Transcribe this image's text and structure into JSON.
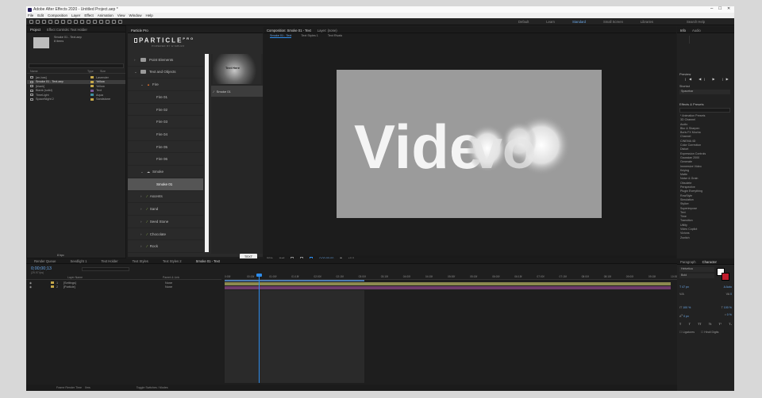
{
  "app": {
    "title": "Adobe After Effects 2020 - Untitled Project.aep *"
  },
  "menu": [
    "File",
    "Edit",
    "Composition",
    "Layer",
    "Effect",
    "Animation",
    "View",
    "Window",
    "Help"
  ],
  "workspaces": [
    "Default",
    "Learn",
    "Standard",
    "Small Screen",
    "Libraries"
  ],
  "search_label": "Search Help",
  "project": {
    "tabs": [
      "Project",
      "Effect Controls: Text Holder"
    ],
    "selected_name": "Smoke 01 - Text.aep",
    "items_label": "8 items",
    "columns": [
      "Name",
      "Type",
      "Size"
    ],
    "items": [
      {
        "name": "[an-bas]",
        "color": "#c6a84a",
        "type": "Lavender"
      },
      {
        "name": "Smoke 01 - Text.aep",
        "color": "#c6a84a",
        "type": "Yellow"
      },
      {
        "name": "[blank]",
        "color": "#c6a84a",
        "type": "Yellow"
      },
      {
        "name": "Blank (solid)",
        "color": "#7a5a9a",
        "type": "Text"
      },
      {
        "name": "TimeLight",
        "color": "#3e8fa0",
        "type": "Aqua"
      },
      {
        "name": "SpaceNight 2",
        "color": "#c6a84a",
        "type": "Sandstone"
      }
    ],
    "bpc": "8 bpc"
  },
  "particle": {
    "header": "Particle Pro",
    "logo": "PARTICLE",
    "logo_sup": "PRO",
    "logo_sub": "POWERED BY EYEBUZZ",
    "tree": [
      {
        "label": "Point Elements",
        "indent": 0,
        "caret": ">",
        "type": "folder"
      },
      {
        "label": "Text and Objects",
        "indent": 0,
        "caret": "v",
        "type": "folder"
      },
      {
        "label": "Fire",
        "indent": 1,
        "caret": "v",
        "type": "fire"
      },
      {
        "label": "Fire 01",
        "indent": 2,
        "caret": "",
        "type": "item"
      },
      {
        "label": "Fire 02",
        "indent": 2,
        "caret": "",
        "type": "item"
      },
      {
        "label": "Fire 03",
        "indent": 2,
        "caret": "",
        "type": "item"
      },
      {
        "label": "Fire 04",
        "indent": 2,
        "caret": "",
        "type": "item"
      },
      {
        "label": "Fire 05",
        "indent": 2,
        "caret": "",
        "type": "item"
      },
      {
        "label": "Fire 06",
        "indent": 2,
        "caret": "",
        "type": "item"
      },
      {
        "label": "Smoke",
        "indent": 1,
        "caret": "v",
        "type": "smoke"
      },
      {
        "label": "Smoke 01",
        "indent": 2,
        "caret": "",
        "type": "item",
        "selected": true
      },
      {
        "label": "Ascents",
        "indent": 1,
        "caret": ">",
        "type": "tool"
      },
      {
        "label": "Sand",
        "indent": 1,
        "caret": ">",
        "type": "tool"
      },
      {
        "label": "Seed Stone",
        "indent": 1,
        "caret": ">",
        "type": "tool"
      },
      {
        "label": "Chocolate",
        "indent": 1,
        "caret": ">",
        "type": "tool"
      },
      {
        "label": "Rock",
        "indent": 1,
        "caret": ">",
        "type": "tool"
      }
    ],
    "preview_label": "Text Here",
    "preview_item": "Smoke 01",
    "text_button": "TEXT"
  },
  "comp": {
    "tabs": [
      "Composition: Smoke 01 - Text",
      "Layer: (none)"
    ],
    "subtabs": [
      "Smoke 01 - Text",
      "Text Styles 1",
      "Text Rivals"
    ],
    "word_left": "Vide",
    "word_right": "vo",
    "zoom": "50%",
    "resolution": "Half",
    "timecode": "0;00;00;00",
    "magnification": "+0.0"
  },
  "right": {
    "info_tabs": [
      "Info",
      "Audio"
    ],
    "preview_label": "Preview",
    "preview_sub": "Shortcut",
    "preview_value": "Spacebar",
    "effects_header": "Effects & Presets",
    "effects": [
      "* Animation Presets",
      "3D Channel",
      "Audio",
      "Blur & Sharpen",
      "Boris FX Mocha",
      "Channel",
      "CINEMA 4D",
      "Color Correction",
      "Distort",
      "Expression Controls",
      "Gaussian 2000",
      "Generate",
      "Immersive Video",
      "Keying",
      "Matte",
      "Noise & Grain",
      "Obsolete",
      "Perspective",
      "Plugin Everything",
      "RowStyle",
      "Simulation",
      "Stylize",
      "Superimpose",
      "Text",
      "Time",
      "Transition",
      "Utility",
      "Video Copilot",
      "Vizions",
      "Zsnitch"
    ]
  },
  "timeline": {
    "tabs": [
      "Render Queue",
      "Seedlight 1",
      "Text Holder",
      "Text Styles",
      "Text Styles 2",
      "Smoke 01 - Text"
    ],
    "timecode": "0;00;00;13",
    "fps": "(29.97 fps)",
    "layer_header": "Layer Name",
    "parent_header": "Parent & Link",
    "layers": [
      {
        "num": "1",
        "name": "[Settings]",
        "color": "#c6a84a",
        "parent": "None"
      },
      {
        "num": "2",
        "name": "[Particle]",
        "color": "#c6a84a",
        "parent": "None"
      }
    ],
    "ruler": [
      "0:00f",
      "00:15f",
      "01:00f",
      "01:15f",
      "02:00f",
      "02:15f",
      "03:00f",
      "03:15f",
      "04:00f",
      "04:15f",
      "05:00f",
      "05:15f",
      "06:00f",
      "06:15f",
      "07:00f",
      "07:15f",
      "08:00f",
      "08:15f",
      "09:00f",
      "09:15f",
      "10:00f"
    ],
    "footer_left": "Frame Render Time",
    "footer_left_value": "0ms",
    "footer_mid": "Toggle Switches / Modes"
  },
  "character": {
    "tabs": [
      "Paragraph",
      "Character"
    ],
    "font": "Helvetica",
    "style": "Bold",
    "size": "47 px",
    "leading": "Auto",
    "tracking": "0",
    "scale_v": "100 %",
    "scale_h": "100 %",
    "baseline": "0 px",
    "tsume": "0 %",
    "ligatures": "Ligatures",
    "hindi": "Hindi Digits"
  },
  "colors": {
    "accent_blue": "#2d8ceb",
    "label_yellow": "#c6a84a",
    "label_purple": "#7a5a9a"
  }
}
